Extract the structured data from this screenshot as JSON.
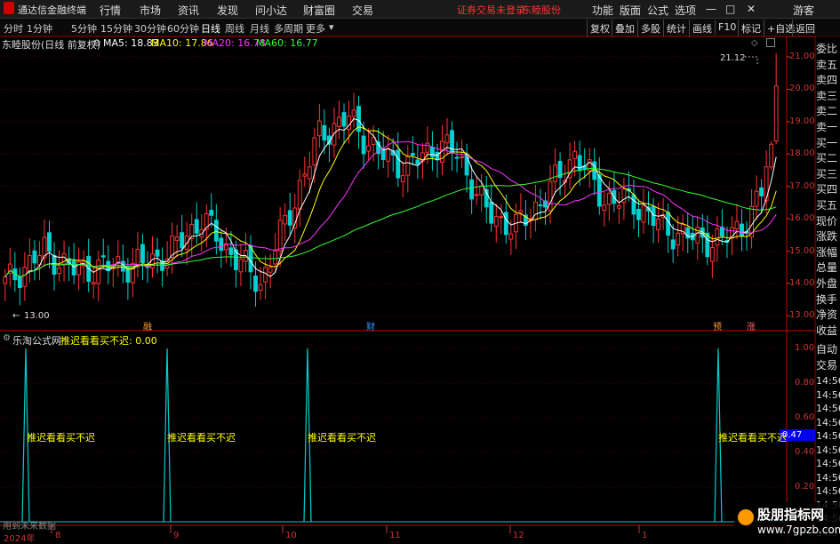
{
  "menubar": {
    "app_title": "通达信金融终端",
    "items": [
      "行情",
      "市场",
      "资讯",
      "发现",
      "问小达",
      "财富圈",
      "交易"
    ],
    "notice": "证券交易未登录",
    "stock": "东睦股份",
    "right_items": [
      "功能",
      "版面",
      "公式",
      "选项",
      "游客"
    ]
  },
  "toolbar": {
    "periods": [
      "分时",
      "1分钟",
      "5分钟",
      "15分钟",
      "30分钟",
      "60分钟",
      "日线",
      "周线",
      "月线",
      "多周期",
      "更多"
    ],
    "active_period": "日线",
    "right_buttons": [
      "复权",
      "叠加",
      "多股",
      "统计",
      "画线",
      "F10",
      "标记",
      "+自选",
      "返回"
    ]
  },
  "main_chart": {
    "title": "东睦股份(日线 前复权)",
    "ma_labels": [
      {
        "text": "MA5: 18.83",
        "color": "#ffffff"
      },
      {
        "text": "MA10: 17.86",
        "color": "#ffff00"
      },
      {
        "text": "MA20: 16.78",
        "color": "#ff33ff"
      },
      {
        "text": "MA60: 16.77",
        "color": "#33ff33"
      }
    ],
    "price_ticks": [
      "21.00",
      "20.00",
      "19.00",
      "18.00",
      "17.00",
      "16.00",
      "15.00",
      "14.00",
      "13.00"
    ],
    "high_label": "21.12",
    "low_label": "13.00",
    "event_marks": [
      {
        "text": "融",
        "color": "#ff9933"
      },
      {
        "text": "财",
        "color": "#3399ff"
      },
      {
        "text": "预",
        "color": "#ff9933"
      },
      {
        "text": "涨",
        "color": "#ff6666"
      }
    ]
  },
  "right_panel": {
    "labels": [
      "委比",
      "卖五",
      "卖四",
      "卖三",
      "卖二",
      "卖一",
      "买一",
      "买二",
      "买三",
      "买四",
      "买五",
      "现价",
      "涨跌",
      "涨幅",
      "总量",
      "外盘",
      "换手",
      "净资",
      "收益"
    ],
    "auto_label": "自动",
    "trade_label": "交易",
    "times": [
      "14:56",
      "14:56",
      "14:56",
      "14:56",
      "14:56",
      "14:56",
      "14:56",
      "14:56",
      "14:56",
      "14:56",
      "14:56",
      "14:5"
    ]
  },
  "indicator": {
    "title": "乐淘公式网",
    "formula_label": "推迟看看买不迟: 0.00",
    "signal_text": "推迟看看买不迟",
    "y_ticks": [
      "1.00",
      "0.80",
      "0.60",
      "0.40",
      "0.20"
    ],
    "cursor_value": "0.47",
    "footer_note": "用到未来数据"
  },
  "x_axis": {
    "labels": [
      "2024年",
      "8",
      "9",
      "10",
      "11",
      "12",
      "1"
    ]
  },
  "watermark": {
    "title": "股朋指标网",
    "url": "www.7gpzb.com"
  },
  "colors": {
    "up": "#ff3333",
    "down": "#00d0d0",
    "grid": "#8b0000",
    "ma60": "#33ff33"
  }
}
